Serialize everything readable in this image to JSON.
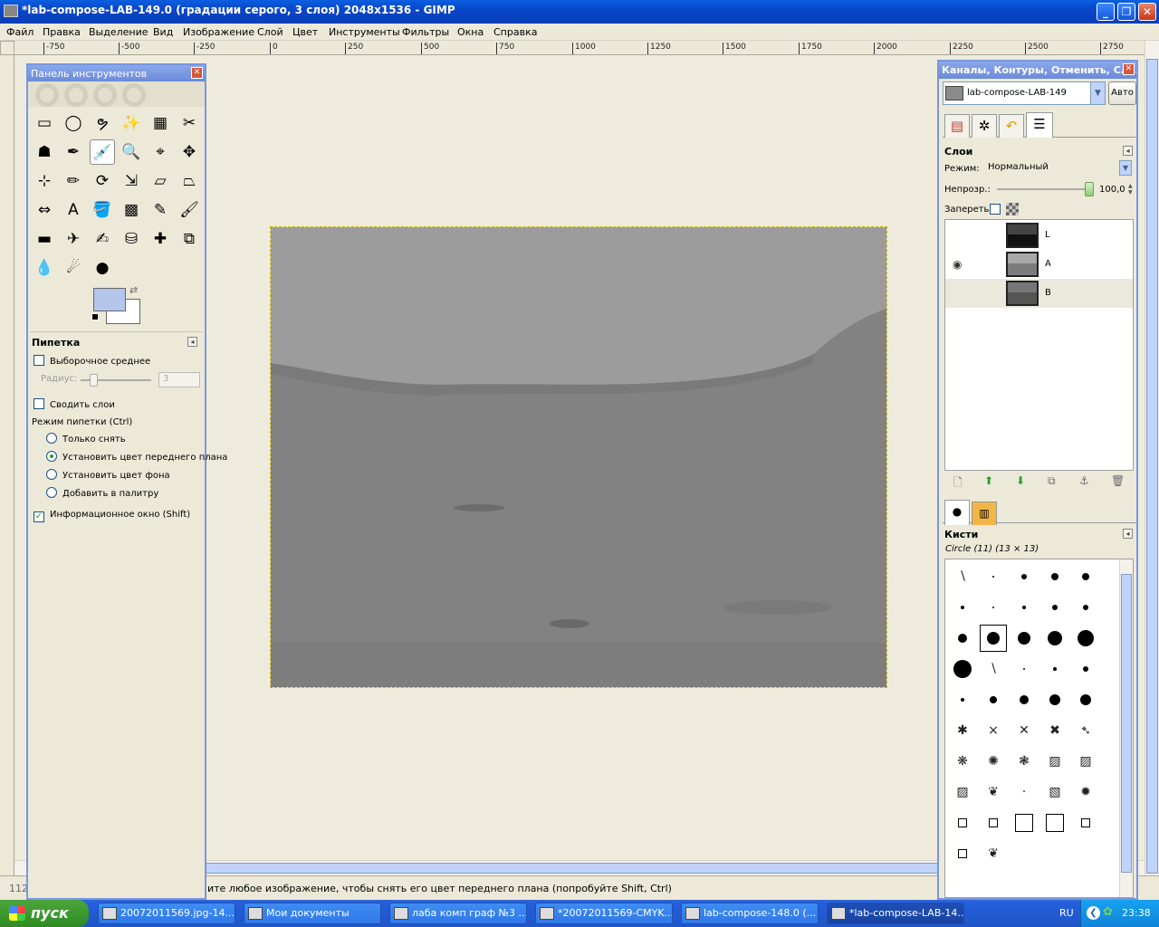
{
  "window": {
    "title": "*lab-compose-LAB-149.0 (градации серого, 3 слоя) 2048x1536 - GIMP",
    "min": "_",
    "max": "❐",
    "close": "✕"
  },
  "menu": [
    "Файл",
    "Правка",
    "Выделение",
    "Вид",
    "Изображение",
    "Слой",
    "Цвет",
    "Инструменты",
    "Фильтры",
    "Окна",
    "Справка"
  ],
  "ruler_ticks": [
    "-750",
    "-500",
    "-250",
    "0",
    "250",
    "500",
    "750",
    "1000",
    "1250",
    "1500",
    "1750",
    "2000",
    "2250",
    "2500",
    "2750"
  ],
  "status": {
    "coords": "112",
    "message": "ите любое изображение, чтобы снять его цвет переднего плана (попробуйте Shift, Ctrl)"
  },
  "toolbox": {
    "title": "Панель инструментов",
    "close": "✕",
    "tools": [
      {
        "icon": "▭",
        "name": "rect-select-icon"
      },
      {
        "icon": "◯",
        "name": "ellipse-select-icon"
      },
      {
        "icon": "ຯ",
        "name": "free-select-icon"
      },
      {
        "icon": "✨",
        "name": "fuzzy-select-icon"
      },
      {
        "icon": "▦",
        "name": "color-select-icon"
      },
      {
        "icon": "✂",
        "name": "scissors-icon"
      },
      {
        "icon": "☗",
        "name": "foreground-select-icon"
      },
      {
        "icon": "✒",
        "name": "paths-icon"
      },
      {
        "icon": "💉",
        "name": "color-picker-icon"
      },
      {
        "icon": "🔍",
        "name": "zoom-icon"
      },
      {
        "icon": "⌖",
        "name": "measure-icon"
      },
      {
        "icon": "✥",
        "name": "move-icon"
      },
      {
        "icon": "⊹",
        "name": "align-icon"
      },
      {
        "icon": "✏",
        "name": "crop-icon"
      },
      {
        "icon": "⟳",
        "name": "rotate-icon"
      },
      {
        "icon": "⇲",
        "name": "scale-icon"
      },
      {
        "icon": "▱",
        "name": "shear-icon"
      },
      {
        "icon": "⏢",
        "name": "perspective-icon"
      },
      {
        "icon": "⇔",
        "name": "flip-icon"
      },
      {
        "icon": "A",
        "name": "text-icon"
      },
      {
        "icon": "🪣",
        "name": "bucket-fill-icon"
      },
      {
        "icon": "▩",
        "name": "blend-icon"
      },
      {
        "icon": "✎",
        "name": "pencil-icon"
      },
      {
        "icon": "🖌",
        "name": "paintbrush-icon"
      },
      {
        "icon": "▬",
        "name": "eraser-icon"
      },
      {
        "icon": "✈",
        "name": "airbrush-icon"
      },
      {
        "icon": "✍",
        "name": "ink-icon"
      },
      {
        "icon": "⛁",
        "name": "clone-icon"
      },
      {
        "icon": "✚",
        "name": "heal-icon"
      },
      {
        "icon": "⧉",
        "name": "perspective-clone-icon"
      },
      {
        "icon": "💧",
        "name": "blur-icon"
      },
      {
        "icon": "☄",
        "name": "smudge-icon"
      },
      {
        "icon": "●",
        "name": "dodge-burn-icon"
      }
    ],
    "swap": "⇄",
    "options": {
      "title": "Пипетка",
      "sample_average": "Выборочное среднее",
      "radius_label": "Радиус:",
      "radius_value": "3",
      "merge_layers": "Сводить слои",
      "mode_label": "Режим пипетки (Ctrl)",
      "modes": [
        "Только снять",
        "Установить цвет переднего плана",
        "Установить цвет фона",
        "Добавить в палитру"
      ],
      "selected_mode": 1,
      "info_window": "Информационное окно (Shift)"
    }
  },
  "dock": {
    "title": "Каналы, Контуры, Отменить, Сло...",
    "close": "✕",
    "image_name": "lab-compose-LAB-149",
    "auto": "Авто",
    "layers_title": "Слои",
    "mode_label": "Режим:",
    "mode_value": "Нормальный",
    "opacity_label": "Непрозр.:",
    "opacity_value": "100,0",
    "opacity_percent": 100,
    "lock_label": "Запереть:",
    "layers": [
      {
        "name": "L",
        "visible": false,
        "thumb_top": "#444",
        "thumb_bottom": "#111"
      },
      {
        "name": "A",
        "visible": true,
        "thumb_top": "#a8a8a8",
        "thumb_bottom": "#7c7c7c"
      },
      {
        "name": "B",
        "visible": false,
        "thumb_top": "#777",
        "thumb_bottom": "#555"
      }
    ],
    "selected_layer": 2,
    "brushes_title": "Кисти",
    "brush_name": "Circle (11) (13 × 13)",
    "collapse": "◂"
  },
  "taskbar": {
    "start": "пуск",
    "tasks": [
      "20072011569.jpg-14...",
      "Мои документы",
      "лаба комп граф №3 ...",
      "*20072011569-CMYK...",
      "lab-compose-148.0 (...",
      "*lab-compose-LAB-14..."
    ],
    "active_task": 5,
    "lang": "RU",
    "clock": "23:38"
  },
  "colors": {
    "foreground": "#b4c6ea",
    "background": "#ffffff",
    "canvas": "#efebdc",
    "accent": "#7a96df"
  }
}
